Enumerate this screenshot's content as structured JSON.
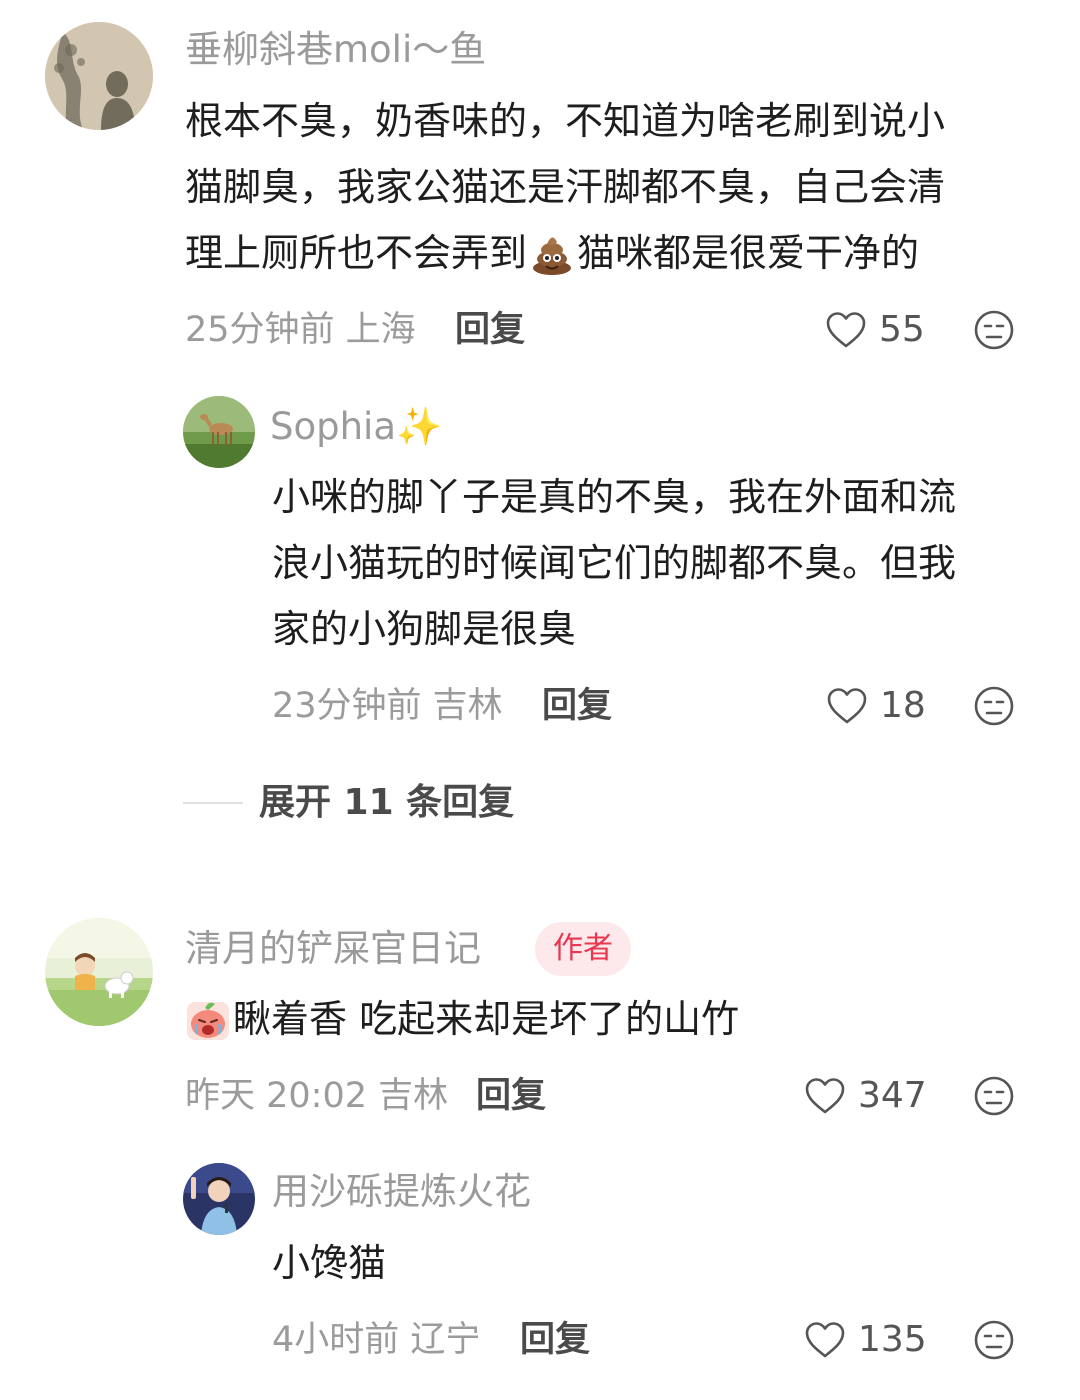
{
  "comments": [
    {
      "username": "垂柳斜巷moli～鱼",
      "lines": [
        "根本不臭，奶香味的，不知道为啥老刷到说小",
        "猫脚臭，我家公猫还是汗脚都不臭，自己会清",
        "理上厕所也不会弄到",
        "猫咪都是很爱干净的"
      ],
      "emoji": "poop-emoji",
      "time_location": "25分钟前 上海",
      "reply_label": "回复",
      "likes": "55",
      "reply": {
        "username": "Sophia",
        "username_emoji": "✨",
        "lines": [
          "小咪的脚丫子是真的不臭，我在外面和流",
          "浪小猫玩的时候闻它们的脚都不臭。但我",
          "家的小狗脚是很臭"
        ],
        "time_location": "23分钟前 吉林",
        "reply_label": "回复",
        "likes": "18"
      },
      "expand_label": "展开 11 条回复"
    },
    {
      "username": "清月的铲屎官日记",
      "author_badge": "作者",
      "text": "瞅着香 吃起来却是坏了的山竹",
      "emoji": "crying-peach-sticker",
      "time_location": "昨天 20:02 吉林",
      "reply_label": "回复",
      "likes": "347",
      "reply": {
        "username": "用沙砾提炼火花",
        "text": "小馋猫",
        "time_location": "4小时前 辽宁",
        "reply_label": "回复",
        "likes": "135"
      }
    }
  ],
  "colors": {
    "username": "#9a9a9a",
    "text": "#1e1e1e",
    "meta": "#9b9b9b",
    "author_badge_bg": "#fde9eb",
    "author_badge_text": "#e8374f"
  }
}
